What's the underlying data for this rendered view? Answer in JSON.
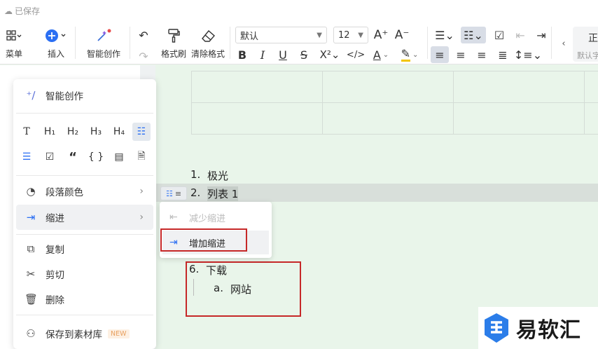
{
  "topbar": {
    "saved_label": "已保存"
  },
  "toolbar": {
    "menu_label": "菜单",
    "insert_label": "插入",
    "ai_label": "智能创作",
    "painter_label": "格式刷",
    "clear_label": "清除格式",
    "font_value": "默认",
    "size_value": "12",
    "style_value": "正",
    "style_label": "默认字"
  },
  "context_menu": {
    "ai_create": "智能创作",
    "heading_buttons": [
      "T",
      "H₁",
      "H₂",
      "H₃",
      "H₄"
    ],
    "paragraph_color": "段落颜色",
    "indent": "缩进",
    "copy": "复制",
    "cut": "剪切",
    "delete": "删除",
    "save_to_library": "保存到素材库",
    "new_badge": "NEW"
  },
  "submenu": {
    "decrease_indent": "减少缩进",
    "increase_indent": "增加缩进"
  },
  "document": {
    "items": [
      {
        "num": "1.",
        "text": "极光"
      },
      {
        "num": "2.",
        "text": "列表 1"
      },
      {
        "num": "6.",
        "text": "下载"
      }
    ],
    "sub_item": {
      "num": "a.",
      "text": "网站"
    }
  },
  "watermark": {
    "text": "易软汇"
  },
  "colors": {
    "accent": "#2b6ff3",
    "highlight_box": "#c62828",
    "canvas": "#e9f5ea"
  }
}
